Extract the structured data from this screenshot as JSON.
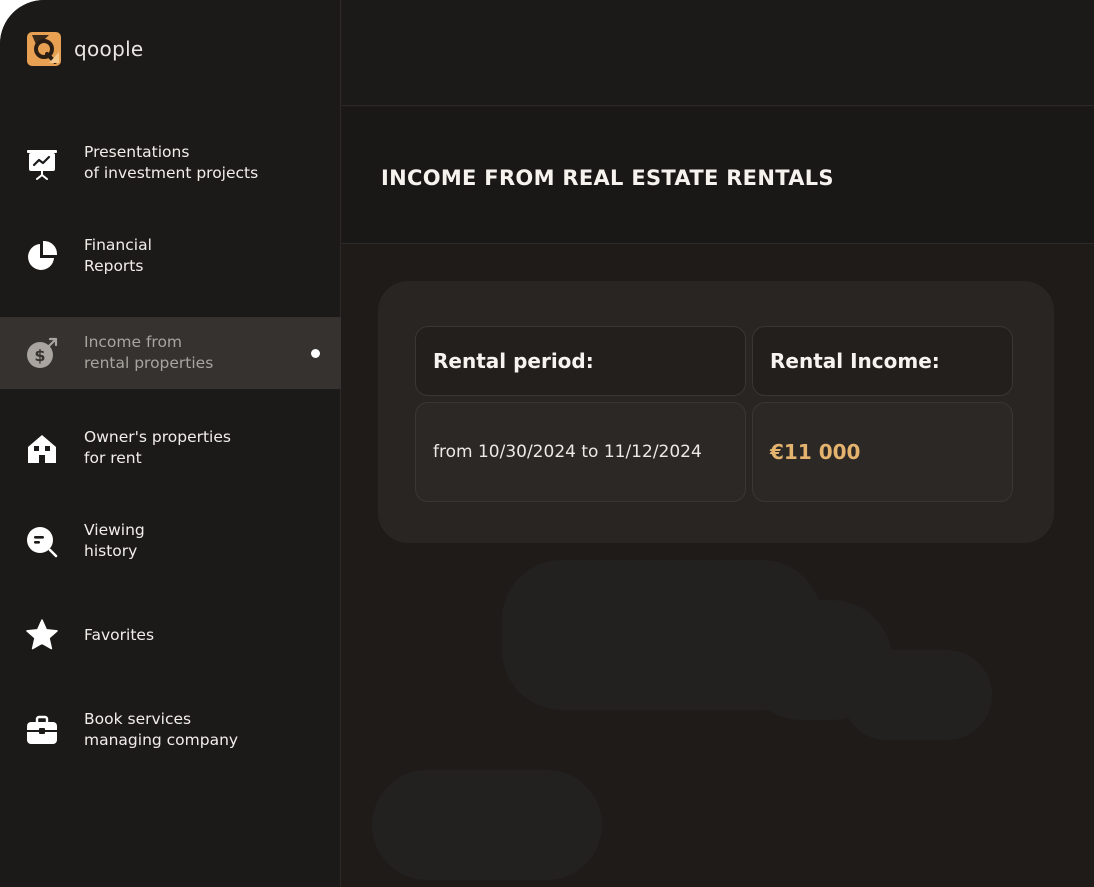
{
  "app": {
    "brand": "qoople"
  },
  "colors": {
    "accent": "#e8a052",
    "money": "#e4b36d",
    "background": "#1e1b19"
  },
  "sidebar": {
    "items": [
      {
        "icon": "presentation-chart-icon",
        "line1": "Presentations",
        "line2": "of investment projects",
        "active": false
      },
      {
        "icon": "pie-chart-icon",
        "line1": "Financial",
        "line2": "Reports",
        "active": false
      },
      {
        "icon": "dollar-coin-icon",
        "line1": "Income from",
        "line2": "rental properties",
        "active": true
      },
      {
        "icon": "house-icon",
        "line1": "Owner's properties",
        "line2": "for rent",
        "active": false
      },
      {
        "icon": "search-history-icon",
        "line1": "Viewing",
        "line2": "history",
        "active": false
      },
      {
        "icon": "star-icon",
        "line1": "Favorites",
        "line2": "",
        "active": false
      },
      {
        "icon": "briefcase-icon",
        "line1": "Book services",
        "line2": "managing company",
        "active": false
      }
    ]
  },
  "main": {
    "title": "INCOME FROM REAL ESTATE RENTALS",
    "table": {
      "headers": [
        "Rental period:",
        "Rental Income:"
      ],
      "rows": [
        {
          "period": "from 10/30/2024 to 11/12/2024",
          "income": "€11 000"
        }
      ]
    }
  }
}
